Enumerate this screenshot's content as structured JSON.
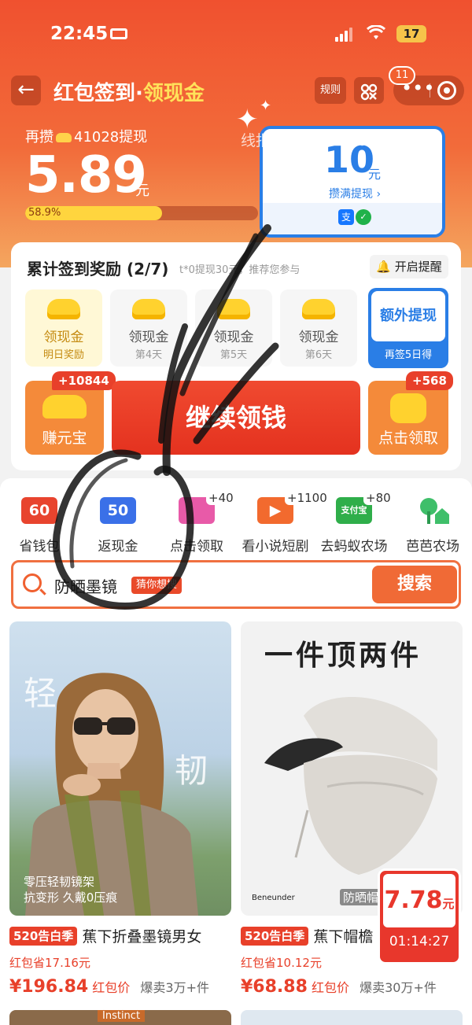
{
  "status_bar": {
    "time": "22:45",
    "battery": "17"
  },
  "nav": {
    "back_icon": "back-arrow-icon",
    "title_main": "红包签到",
    "title_sep": "·",
    "title_accent": "领现金",
    "rules_label": "规则",
    "qr_icon": "qr-code-icon",
    "more_badge": "11"
  },
  "hero": {
    "need_prefix": "再攒",
    "need_amount": "41028",
    "need_suffix": "提现",
    "balance": "5.89",
    "balance_unit": "元",
    "progress_label": "58.9%",
    "progress_fraction": 0.589,
    "watermark": "线报酷-new.xianbao.fun"
  },
  "withdraw_card": {
    "amount": "10",
    "unit": "元",
    "label": "攒满提现 ›"
  },
  "signin": {
    "title": "累计签到奖励 (2/7)",
    "hint": "t*0提现30元，推荐您参与",
    "remind_label": "开启提醒",
    "days": [
      {
        "title": "领现金",
        "sub": "明日奖励"
      },
      {
        "title": "领现金",
        "sub": "第4天"
      },
      {
        "title": "领现金",
        "sub": "第5天"
      },
      {
        "title": "领现金",
        "sub": "第6天"
      }
    ],
    "extra_title": "额外提现",
    "extra_sub": "再签5日得",
    "earn_label": "赚元宝",
    "earn_chip": "+10844",
    "continue_label": "继续领钱",
    "claim_label": "点击领取",
    "claim_chip": "+568"
  },
  "tasks": [
    {
      "label": "省钱包",
      "icon_text": "60",
      "bonus": ""
    },
    {
      "label": "返现金",
      "icon_text": "50",
      "bonus": ""
    },
    {
      "label": "点击领取",
      "icon_text": "",
      "bonus": "+40"
    },
    {
      "label": "看小说短剧",
      "icon_text": "",
      "bonus": "+1100"
    },
    {
      "label": "去蚂蚁农场",
      "icon_text": "",
      "bonus": "+80"
    },
    {
      "label": "芭芭农场",
      "icon_text": "",
      "bonus": ""
    }
  ],
  "search": {
    "query": "防晒墨镜",
    "tag": "猜你想搜",
    "button": "搜索"
  },
  "products": [
    {
      "overlay_big1": "轻",
      "overlay_big2": "韧",
      "overlay_small1": "零压轻韧镜架",
      "overlay_small2": "抗变形 久戴0压痕",
      "tag": "520告白季",
      "name": "蕉下折叠墨镜男女",
      "saving": "红包省17.16元",
      "price": "¥196.84",
      "price_label": "红包价",
      "sold": "爆卖3万+件"
    },
    {
      "headline": "一件顶两件",
      "brand": "Beneunder",
      "corner_tag": "防晒帽",
      "tag": "520告白季",
      "name": "蕉下帽檐",
      "saving": "红包省10.12元",
      "price": "¥68.88",
      "price_label": "红包价",
      "sold": "爆卖30万+件"
    }
  ],
  "timer": {
    "price": "7.78",
    "unit": "元",
    "countdown": "01:14:27"
  },
  "bottom_peek": {
    "label": "Instinct"
  }
}
